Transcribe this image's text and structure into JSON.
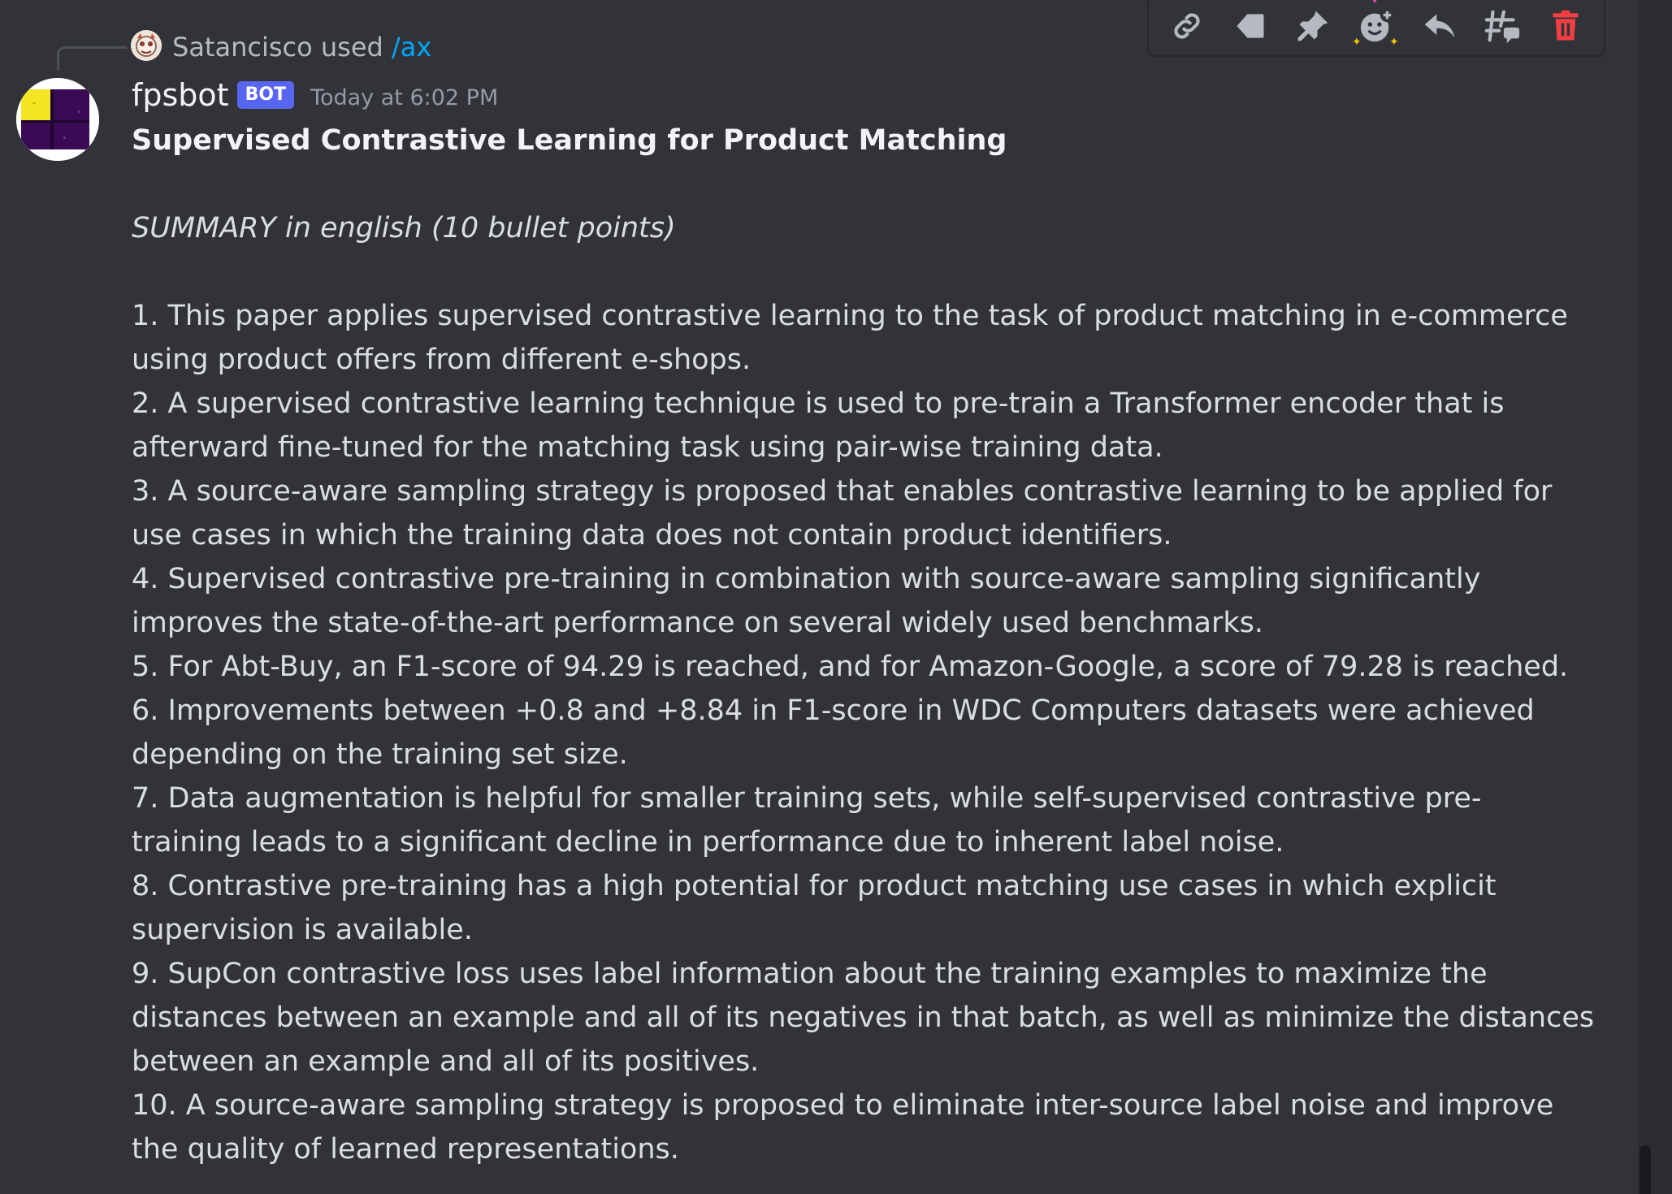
{
  "reply": {
    "user": "Satancisco",
    "action": "used",
    "command": "/ax"
  },
  "message": {
    "author": "fpsbot",
    "badge": "BOT",
    "timestamp": "Today at 6:02 PM",
    "title": "Supervised Contrastive Learning for Product Matching",
    "summary_heading": "SUMMARY in english (10 bullet points)",
    "lines": [
      "1. This paper applies supervised contrastive learning to the task of product matching in e-commerce",
      "using product offers from different e-shops.",
      "2. A supervised contrastive learning technique is used to pre-train a Transformer encoder that is",
      "afterward fine-tuned for the matching task using pair-wise training data.",
      "3. A source-aware sampling strategy is proposed that enables contrastive learning to be applied for",
      "use cases in which the training data does not contain product identifiers.",
      "4. Supervised contrastive pre-training in combination with source-aware sampling significantly",
      "improves the state-of-the-art performance on several widely used benchmarks.",
      "5. For Abt-Buy, an F1-score of 94.29 is reached, and for Amazon-Google, a score of 79.28 is reached.",
      "6. Improvements between +0.8 and +8.84 in F1-score in WDC Computers datasets were achieved",
      "depending on the training set size.",
      "7. Data augmentation is helpful for smaller training sets, while self-supervised contrastive pre-",
      "training leads to a significant decline in performance due to inherent label noise.",
      "8. Contrastive pre-training has a high potential for product matching use cases in which explicit",
      "supervision is available.",
      "9. SupCon contrastive loss uses label information about the training examples to maximize the",
      "distances between an example and all of its negatives in that batch, as well as minimize the distances",
      "between an example and all of its positives.",
      "10. A source-aware sampling strategy is proposed to eliminate inter-source label noise and improve",
      "the quality of learned representations."
    ]
  },
  "toolbar": {
    "icons": [
      "link-icon",
      "mark-unread-icon",
      "pin-icon",
      "add-reaction-icon",
      "reply-icon",
      "create-thread-icon",
      "delete-icon"
    ]
  },
  "colors": {
    "background": "#313338",
    "text": "#dbdee1",
    "muted": "#949ba4",
    "link": "#00a8fc",
    "bot_badge": "#5865f2",
    "danger": "#f23f43"
  }
}
